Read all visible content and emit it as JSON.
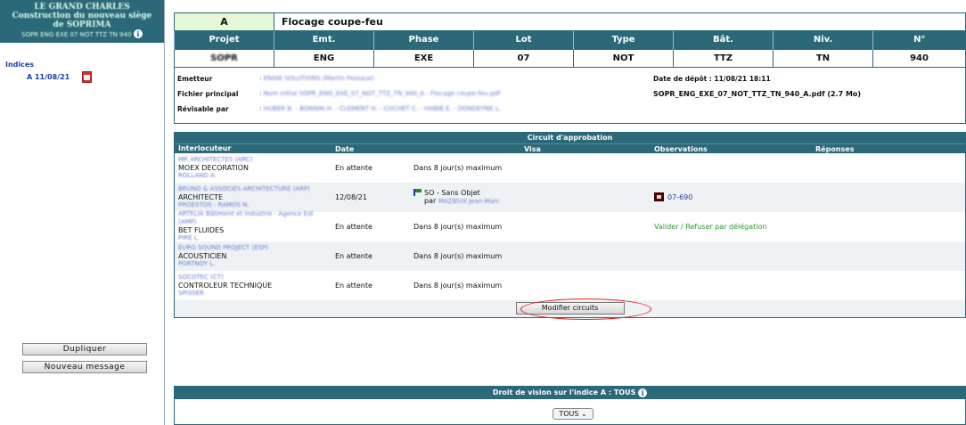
{
  "sidebar": {
    "project_line1": "LE GRAND CHARLES",
    "project_line2": "Construction du nouveau siège",
    "project_line3": "de SOPRIMA",
    "project_code": "SOPR ENG EXE 07 NOT TTZ TN 940",
    "indices_label": "Indices",
    "indice_entry": "A  11/08/21",
    "buttons": {
      "duplicate": "Dupliquer",
      "new_message": "Nouveau message"
    }
  },
  "document": {
    "indice": "A",
    "title": "Flocage coupe-feu",
    "columns": [
      "Projet",
      "Emt.",
      "Phase",
      "Lot",
      "Type",
      "Bât.",
      "Niv.",
      "N°"
    ],
    "values": [
      "SOPR",
      "ENG",
      "EXE",
      "07",
      "NOT",
      "TTZ",
      "TN",
      "940"
    ]
  },
  "details": {
    "emetteur_label": "Emetteur",
    "emetteur_value": "ENGIE SOLUTIONS (Martin Fessaux)",
    "fichier_label": "Fichier principal",
    "fichier_value": "Nom initial SOPR_ENG_EXE_07_NOT_TTZ_TN_940_A - Flocage coupe-feu.pdf",
    "revisable_label": "Révisable par",
    "revisable_value": "HUBER B. - BONNIN H. - CLEMENT H. - COCHET C. - HABIB E. - DONDEYNE L.",
    "depot_label": "Date de dépôt : 11/08/21 18:11",
    "file_name": "SOPR_ENG_EXE_07_NOT_TTZ_TN_940_A.pdf (2.7 Mo)"
  },
  "circuit": {
    "title": "Circuit d'approbation",
    "columns": [
      "Interlocuteur",
      "Date",
      "Visa",
      "Observations",
      "Réponses"
    ],
    "rows": [
      {
        "org": "MR ARCHITECTES (ARC)",
        "role": "MOEX DECORATION",
        "person": "ROLLAND A.",
        "date": "En attente",
        "visa": "Dans 8 jour(s) maximum",
        "obs": ""
      },
      {
        "org": "BRUNO & ASSOCIES ARCHITECTURE (ARP)",
        "role": "ARCHITECTE",
        "person": "PROESTOS - RAMOS N.",
        "date": "12/08/21",
        "visa": "SO - Sans Objet",
        "visa_by": "par",
        "visa_person": "MAZIEUX Jean-Marc",
        "obs": "07-690"
      },
      {
        "org": "ARTELIA Bâtiment et Industrie - Agence Est (AMP)",
        "role": "BET FLUIDES",
        "person": "PIRE L.",
        "date": "En attente",
        "visa": "Dans 8 jour(s) maximum",
        "obs": "Valider / Refuser par délégation"
      },
      {
        "org": "EURO SOUND PROJECT (ESP)",
        "role": "ACOUSTICIEN",
        "person": "PORTNOY L.",
        "date": "En attente",
        "visa": "Dans 8 jour(s) maximum",
        "obs": ""
      },
      {
        "org": "SOCOTEC (CT)",
        "role": "CONTROLEUR TECHNIQUE",
        "person": "SPISSER",
        "date": "En attente",
        "visa": "Dans 8 jour(s) maximum",
        "obs": ""
      }
    ],
    "modify_button": "Modifier circuits"
  },
  "vision": {
    "title": "Droit de vision sur l'indice A  :  TOUS",
    "select_value": "TOUS"
  }
}
